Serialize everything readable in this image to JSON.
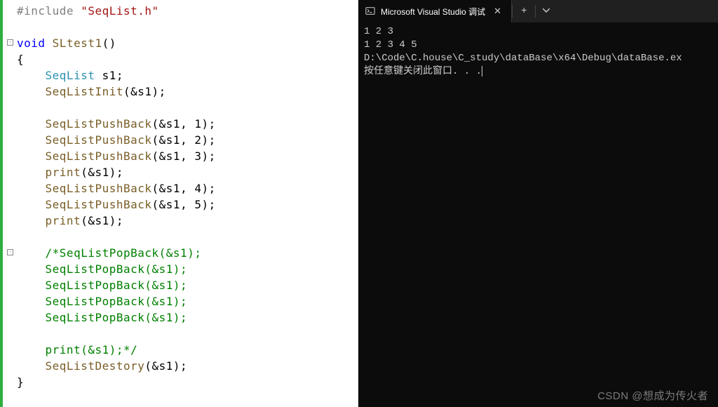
{
  "editor": {
    "lang": "c",
    "code_lines": [
      {
        "tokens": [
          {
            "c": "kw-preproc",
            "t": "#include "
          },
          {
            "c": "kw-string",
            "t": "\"SeqList.h\""
          }
        ]
      },
      {
        "tokens": []
      },
      {
        "tokens": [
          {
            "c": "kw-blue",
            "t": "void"
          },
          {
            "c": "",
            "t": " "
          },
          {
            "c": "kw-func",
            "t": "SLtest1"
          },
          {
            "c": "",
            "t": "()"
          }
        ]
      },
      {
        "tokens": [
          {
            "c": "",
            "t": "{"
          }
        ]
      },
      {
        "tokens": [
          {
            "c": "",
            "t": "    "
          },
          {
            "c": "kw-teal",
            "t": "SeqList"
          },
          {
            "c": "",
            "t": " s1;"
          }
        ]
      },
      {
        "tokens": [
          {
            "c": "",
            "t": "    "
          },
          {
            "c": "kw-func",
            "t": "SeqListInit"
          },
          {
            "c": "",
            "t": "(&s1);"
          }
        ]
      },
      {
        "tokens": []
      },
      {
        "tokens": [
          {
            "c": "",
            "t": "    "
          },
          {
            "c": "kw-func",
            "t": "SeqListPushBack"
          },
          {
            "c": "",
            "t": "(&s1, 1);"
          }
        ]
      },
      {
        "tokens": [
          {
            "c": "",
            "t": "    "
          },
          {
            "c": "kw-func",
            "t": "SeqListPushBack"
          },
          {
            "c": "",
            "t": "(&s1, 2);"
          }
        ]
      },
      {
        "tokens": [
          {
            "c": "",
            "t": "    "
          },
          {
            "c": "kw-func",
            "t": "SeqListPushBack"
          },
          {
            "c": "",
            "t": "(&s1, 3);"
          }
        ]
      },
      {
        "tokens": [
          {
            "c": "",
            "t": "    "
          },
          {
            "c": "kw-func",
            "t": "print"
          },
          {
            "c": "",
            "t": "(&s1);"
          }
        ]
      },
      {
        "tokens": [
          {
            "c": "",
            "t": "    "
          },
          {
            "c": "kw-func",
            "t": "SeqListPushBack"
          },
          {
            "c": "",
            "t": "(&s1, 4);"
          }
        ]
      },
      {
        "tokens": [
          {
            "c": "",
            "t": "    "
          },
          {
            "c": "kw-func",
            "t": "SeqListPushBack"
          },
          {
            "c": "",
            "t": "(&s1, 5);"
          }
        ]
      },
      {
        "tokens": [
          {
            "c": "",
            "t": "    "
          },
          {
            "c": "kw-func",
            "t": "print"
          },
          {
            "c": "",
            "t": "(&s1);"
          }
        ]
      },
      {
        "tokens": []
      },
      {
        "tokens": [
          {
            "c": "",
            "t": "    "
          },
          {
            "c": "kw-comment",
            "t": "/*SeqListPopBack(&s1);"
          }
        ]
      },
      {
        "tokens": [
          {
            "c": "",
            "t": "    "
          },
          {
            "c": "kw-comment",
            "t": "SeqListPopBack(&s1);"
          }
        ]
      },
      {
        "tokens": [
          {
            "c": "",
            "t": "    "
          },
          {
            "c": "kw-comment",
            "t": "SeqListPopBack(&s1);"
          }
        ]
      },
      {
        "tokens": [
          {
            "c": "",
            "t": "    "
          },
          {
            "c": "kw-comment",
            "t": "SeqListPopBack(&s1);"
          }
        ]
      },
      {
        "tokens": [
          {
            "c": "",
            "t": "    "
          },
          {
            "c": "kw-comment",
            "t": "SeqListPopBack(&s1);"
          }
        ]
      },
      {
        "tokens": []
      },
      {
        "tokens": [
          {
            "c": "",
            "t": "    "
          },
          {
            "c": "kw-comment",
            "t": "print(&s1);*/"
          }
        ]
      },
      {
        "tokens": [
          {
            "c": "",
            "t": "    "
          },
          {
            "c": "kw-func",
            "t": "SeqListDestory"
          },
          {
            "c": "",
            "t": "(&s1);"
          }
        ]
      },
      {
        "tokens": [
          {
            "c": "",
            "t": "}"
          }
        ]
      }
    ],
    "fold_markers": [
      {
        "line": 2,
        "s": "⊟"
      },
      {
        "line": 15,
        "s": "⊟"
      }
    ]
  },
  "terminal": {
    "tab_title": "Microsoft Visual Studio 调试",
    "output": [
      "1 2 3",
      "1 2 3 4 5",
      "",
      "D:\\Code\\C.house\\C_study\\dataBase\\x64\\Debug\\dataBase.ex",
      "按任意键关闭此窗口. . ."
    ]
  },
  "watermark": {
    "platform": "CSDN",
    "handle": "@想成为传火者"
  }
}
